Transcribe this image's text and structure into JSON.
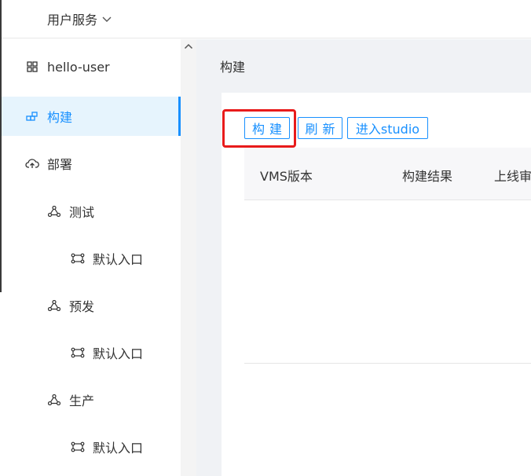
{
  "header": {
    "service_name": "用户服务"
  },
  "sidebar": {
    "items": [
      {
        "label": "hello-user",
        "icon": "grid-icon",
        "level": 0,
        "active": false
      },
      {
        "label": "构建",
        "icon": "build-icon",
        "level": 0,
        "active": true
      },
      {
        "label": "部署",
        "icon": "cloud-upload-icon",
        "level": 0,
        "active": false
      },
      {
        "label": "测试",
        "icon": "cluster-icon",
        "level": 1,
        "active": false
      },
      {
        "label": "默认入口",
        "icon": "gateway-icon",
        "level": 2,
        "active": false
      },
      {
        "label": "预发",
        "icon": "cluster-icon",
        "level": 1,
        "active": false
      },
      {
        "label": "默认入口",
        "icon": "gateway-icon",
        "level": 2,
        "active": false
      },
      {
        "label": "生产",
        "icon": "cluster-icon",
        "level": 1,
        "active": false
      },
      {
        "label": "默认入口",
        "icon": "gateway-icon",
        "level": 2,
        "active": false
      }
    ]
  },
  "main": {
    "title": "构建",
    "buttons": {
      "build": "构建",
      "refresh": "刷新",
      "studio": "进入studio"
    },
    "table": {
      "columns": [
        "VMS版本",
        "构建结果",
        "上线审"
      ]
    }
  },
  "colors": {
    "accent": "#1890ff",
    "active_bg": "#e6f4fd",
    "highlight": "#e81b1b"
  }
}
